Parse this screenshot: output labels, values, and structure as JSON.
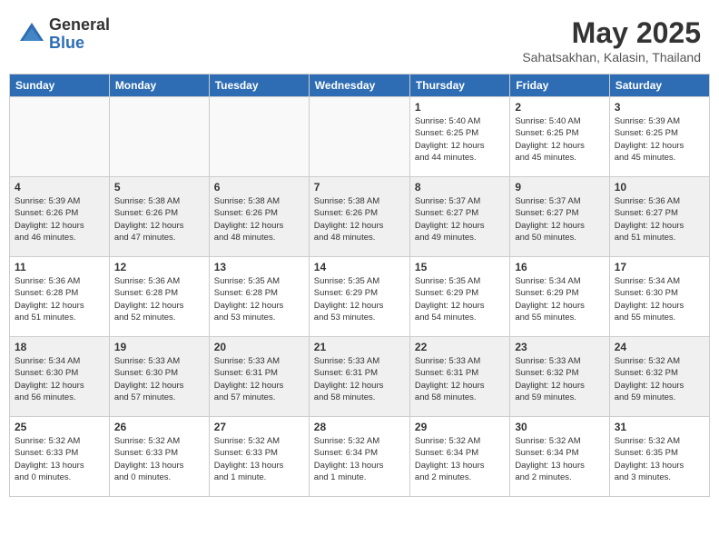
{
  "logo": {
    "general": "General",
    "blue": "Blue"
  },
  "title": "May 2025",
  "subtitle": "Sahatsakhan, Kalasin, Thailand",
  "headers": [
    "Sunday",
    "Monday",
    "Tuesday",
    "Wednesday",
    "Thursday",
    "Friday",
    "Saturday"
  ],
  "weeks": [
    [
      {
        "num": "",
        "info": ""
      },
      {
        "num": "",
        "info": ""
      },
      {
        "num": "",
        "info": ""
      },
      {
        "num": "",
        "info": ""
      },
      {
        "num": "1",
        "info": "Sunrise: 5:40 AM\nSunset: 6:25 PM\nDaylight: 12 hours\nand 44 minutes."
      },
      {
        "num": "2",
        "info": "Sunrise: 5:40 AM\nSunset: 6:25 PM\nDaylight: 12 hours\nand 45 minutes."
      },
      {
        "num": "3",
        "info": "Sunrise: 5:39 AM\nSunset: 6:25 PM\nDaylight: 12 hours\nand 45 minutes."
      }
    ],
    [
      {
        "num": "4",
        "info": "Sunrise: 5:39 AM\nSunset: 6:26 PM\nDaylight: 12 hours\nand 46 minutes."
      },
      {
        "num": "5",
        "info": "Sunrise: 5:38 AM\nSunset: 6:26 PM\nDaylight: 12 hours\nand 47 minutes."
      },
      {
        "num": "6",
        "info": "Sunrise: 5:38 AM\nSunset: 6:26 PM\nDaylight: 12 hours\nand 48 minutes."
      },
      {
        "num": "7",
        "info": "Sunrise: 5:38 AM\nSunset: 6:26 PM\nDaylight: 12 hours\nand 48 minutes."
      },
      {
        "num": "8",
        "info": "Sunrise: 5:37 AM\nSunset: 6:27 PM\nDaylight: 12 hours\nand 49 minutes."
      },
      {
        "num": "9",
        "info": "Sunrise: 5:37 AM\nSunset: 6:27 PM\nDaylight: 12 hours\nand 50 minutes."
      },
      {
        "num": "10",
        "info": "Sunrise: 5:36 AM\nSunset: 6:27 PM\nDaylight: 12 hours\nand 51 minutes."
      }
    ],
    [
      {
        "num": "11",
        "info": "Sunrise: 5:36 AM\nSunset: 6:28 PM\nDaylight: 12 hours\nand 51 minutes."
      },
      {
        "num": "12",
        "info": "Sunrise: 5:36 AM\nSunset: 6:28 PM\nDaylight: 12 hours\nand 52 minutes."
      },
      {
        "num": "13",
        "info": "Sunrise: 5:35 AM\nSunset: 6:28 PM\nDaylight: 12 hours\nand 53 minutes."
      },
      {
        "num": "14",
        "info": "Sunrise: 5:35 AM\nSunset: 6:29 PM\nDaylight: 12 hours\nand 53 minutes."
      },
      {
        "num": "15",
        "info": "Sunrise: 5:35 AM\nSunset: 6:29 PM\nDaylight: 12 hours\nand 54 minutes."
      },
      {
        "num": "16",
        "info": "Sunrise: 5:34 AM\nSunset: 6:29 PM\nDaylight: 12 hours\nand 55 minutes."
      },
      {
        "num": "17",
        "info": "Sunrise: 5:34 AM\nSunset: 6:30 PM\nDaylight: 12 hours\nand 55 minutes."
      }
    ],
    [
      {
        "num": "18",
        "info": "Sunrise: 5:34 AM\nSunset: 6:30 PM\nDaylight: 12 hours\nand 56 minutes."
      },
      {
        "num": "19",
        "info": "Sunrise: 5:33 AM\nSunset: 6:30 PM\nDaylight: 12 hours\nand 57 minutes."
      },
      {
        "num": "20",
        "info": "Sunrise: 5:33 AM\nSunset: 6:31 PM\nDaylight: 12 hours\nand 57 minutes."
      },
      {
        "num": "21",
        "info": "Sunrise: 5:33 AM\nSunset: 6:31 PM\nDaylight: 12 hours\nand 58 minutes."
      },
      {
        "num": "22",
        "info": "Sunrise: 5:33 AM\nSunset: 6:31 PM\nDaylight: 12 hours\nand 58 minutes."
      },
      {
        "num": "23",
        "info": "Sunrise: 5:33 AM\nSunset: 6:32 PM\nDaylight: 12 hours\nand 59 minutes."
      },
      {
        "num": "24",
        "info": "Sunrise: 5:32 AM\nSunset: 6:32 PM\nDaylight: 12 hours\nand 59 minutes."
      }
    ],
    [
      {
        "num": "25",
        "info": "Sunrise: 5:32 AM\nSunset: 6:33 PM\nDaylight: 13 hours\nand 0 minutes."
      },
      {
        "num": "26",
        "info": "Sunrise: 5:32 AM\nSunset: 6:33 PM\nDaylight: 13 hours\nand 0 minutes."
      },
      {
        "num": "27",
        "info": "Sunrise: 5:32 AM\nSunset: 6:33 PM\nDaylight: 13 hours\nand 1 minute."
      },
      {
        "num": "28",
        "info": "Sunrise: 5:32 AM\nSunset: 6:34 PM\nDaylight: 13 hours\nand 1 minute."
      },
      {
        "num": "29",
        "info": "Sunrise: 5:32 AM\nSunset: 6:34 PM\nDaylight: 13 hours\nand 2 minutes."
      },
      {
        "num": "30",
        "info": "Sunrise: 5:32 AM\nSunset: 6:34 PM\nDaylight: 13 hours\nand 2 minutes."
      },
      {
        "num": "31",
        "info": "Sunrise: 5:32 AM\nSunset: 6:35 PM\nDaylight: 13 hours\nand 3 minutes."
      }
    ]
  ]
}
